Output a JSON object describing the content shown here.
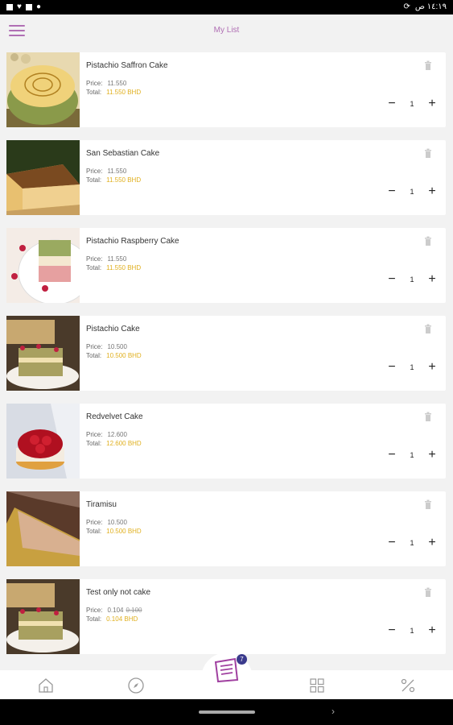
{
  "status_bar": {
    "time": "١٤:١٩ ص"
  },
  "header": {
    "title": "My List"
  },
  "labels": {
    "price": "Price:",
    "total": "Total:"
  },
  "items": [
    {
      "name": "Pistachio Saffron Cake",
      "price": "11.550",
      "old_price": "",
      "total": "11.550 BHD",
      "quantity": "1",
      "image": "pistachio-saffron-cake-photo"
    },
    {
      "name": "San Sebastian Cake",
      "price": "11.550",
      "old_price": "",
      "total": "11.550 BHD",
      "quantity": "1",
      "image": "san-sebastian-cake-photo"
    },
    {
      "name": "Pistachio Raspberry Cake",
      "price": "11.550",
      "old_price": "",
      "total": "11.550 BHD",
      "quantity": "1",
      "image": "pistachio-raspberry-cake-photo"
    },
    {
      "name": "Pistachio Cake",
      "price": "10.500",
      "old_price": "",
      "total": "10.500 BHD",
      "quantity": "1",
      "image": "pistachio-cake-photo"
    },
    {
      "name": "Redvelvet Cake",
      "price": "12.600",
      "old_price": "",
      "total": "12.600 BHD",
      "quantity": "1",
      "image": "redvelvet-cake-photo"
    },
    {
      "name": "Tiramisu",
      "price": "10.500",
      "old_price": "",
      "total": "10.500 BHD",
      "quantity": "1",
      "image": "tiramisu-photo"
    },
    {
      "name": "Test only not cake",
      "price": "0.104",
      "old_price": "0.100",
      "total": "0.104 BHD",
      "quantity": "1",
      "image": "test-item-photo"
    }
  ],
  "cart_badge": "7",
  "nav": [
    "home-icon",
    "explore-icon",
    "cart-list-icon",
    "grid-icon",
    "percent-icon"
  ],
  "colors": {
    "accent": "#b06fb4",
    "total": "#e0b020",
    "badge": "#3a3a8c"
  }
}
